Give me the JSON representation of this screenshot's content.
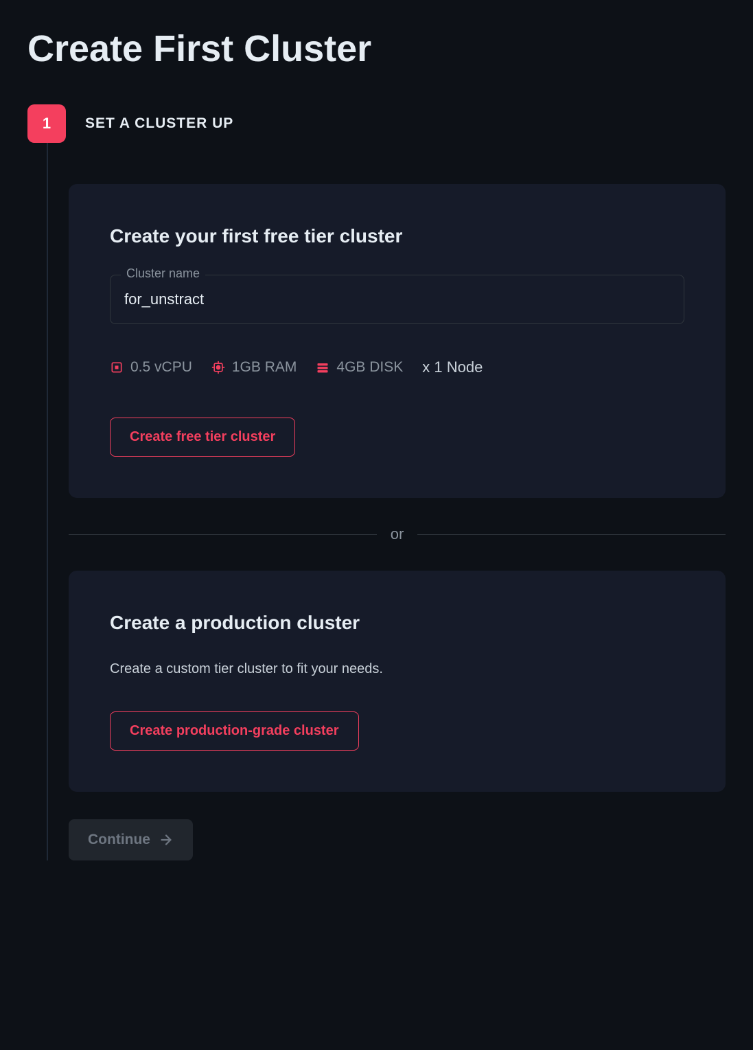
{
  "page": {
    "title": "Create First Cluster"
  },
  "step": {
    "number": "1",
    "label": "SET A CLUSTER UP"
  },
  "free_tier_card": {
    "title": "Create your first free tier cluster",
    "input_label": "Cluster name",
    "input_value": "for_unstract",
    "specs": {
      "cpu": "0.5 vCPU",
      "ram": "1GB RAM",
      "disk": "4GB DISK",
      "nodes": "x 1 Node"
    },
    "button_label": "Create free tier cluster"
  },
  "divider": {
    "text": "or"
  },
  "production_card": {
    "title": "Create a production cluster",
    "subtitle": "Create a custom tier cluster to fit your needs.",
    "button_label": "Create production-grade cluster"
  },
  "continue": {
    "label": "Continue"
  }
}
